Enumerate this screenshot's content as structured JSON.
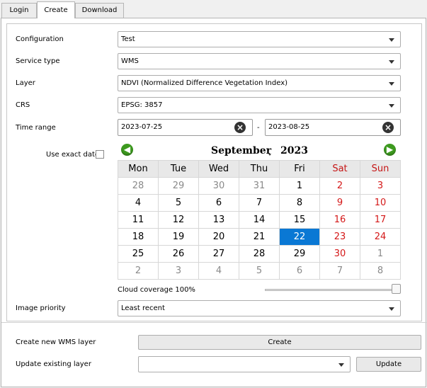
{
  "tabs": [
    {
      "label": "Login"
    },
    {
      "label": "Create"
    },
    {
      "label": "Download"
    }
  ],
  "form": {
    "configuration": {
      "label": "Configuration",
      "value": "Test"
    },
    "service_type": {
      "label": "Service type",
      "value": "WMS"
    },
    "layer": {
      "label": "Layer",
      "value": "NDVI (Normalized Difference Vegetation Index)"
    },
    "crs": {
      "label": "CRS",
      "value": "EPSG: 3857"
    },
    "time_range": {
      "label": "Time range",
      "start": "2023-07-25",
      "separator": "-",
      "end": "2023-08-25"
    },
    "exact_date": {
      "label": "Use exact date",
      "checked": false
    }
  },
  "calendar": {
    "month": "September",
    "year": "2023",
    "weekdays": [
      "Mon",
      "Tue",
      "Wed",
      "Thu",
      "Fri",
      "Sat",
      "Sun"
    ],
    "weeks": [
      [
        "28",
        "29",
        "30",
        "31",
        "1",
        "2",
        "3"
      ],
      [
        "4",
        "5",
        "6",
        "7",
        "8",
        "9",
        "10"
      ],
      [
        "11",
        "12",
        "13",
        "14",
        "15",
        "16",
        "17"
      ],
      [
        "18",
        "19",
        "20",
        "21",
        "22",
        "23",
        "24"
      ],
      [
        "25",
        "26",
        "27",
        "28",
        "29",
        "30",
        "1"
      ],
      [
        "2",
        "3",
        "4",
        "5",
        "6",
        "7",
        "8"
      ]
    ],
    "selected": "22",
    "colors": {
      "weekend": "#d41818",
      "selected_bg": "#0a78d4",
      "nav": "#3d9a1f"
    },
    "prev_icon": "arrow-left-icon",
    "next_icon": "arrow-right-icon"
  },
  "cloud": {
    "label": "Cloud coverage 100%",
    "value_fraction": 1.0
  },
  "image_priority": {
    "label": "Image priority",
    "value": "Least recent"
  },
  "create": {
    "label": "Create new WMS layer",
    "button": "Create"
  },
  "update": {
    "label": "Update existing layer",
    "value": "",
    "button": "Update"
  }
}
